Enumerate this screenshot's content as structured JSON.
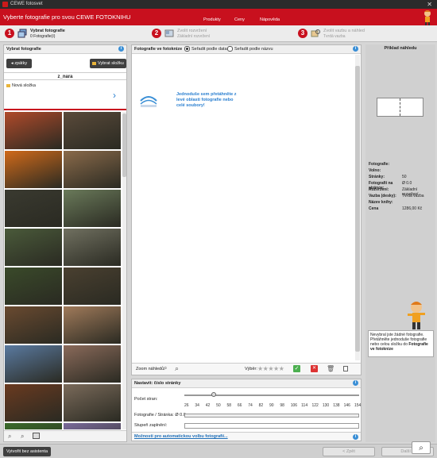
{
  "titlebar": {
    "title": "CEWE fotosvet"
  },
  "header": {
    "title": "Vyberte fotografie pro svou CEWE FOTOKNIHU",
    "nav": [
      "Produkty",
      "Ceny",
      "Nápověda"
    ],
    "assistant": "Asistent CEWE FOTOKNIHY"
  },
  "steps": [
    {
      "num": "1",
      "title": "Vybrat fotografie",
      "subtitle": "0 Fotografie(í)"
    },
    {
      "num": "2",
      "title": "Zvolit rozvržení",
      "subtitle": "Základní rozvržení"
    },
    {
      "num": "3",
      "title": "Zvolit vazbu a náhled",
      "subtitle": "Tvrdá vazba"
    }
  ],
  "left": {
    "heading": "Vybrat fotografie",
    "back": "zpátky",
    "pick_folder": "Vybrat složku",
    "folder_name": "z_nara",
    "new_folder": "Nová složka",
    "photo_colors": [
      "#b04a2a",
      "#5a4a3a",
      "#d06a1a",
      "#8a6a4a",
      "#3a3a30",
      "#6a7a5a",
      "#4a5a3a",
      "#707060",
      "#3a4a2a",
      "#4a4030",
      "#6a4a30",
      "#a07a5a",
      "#5a7aa0",
      "#8a6a5a",
      "#6a3a20",
      "#7a6a5a",
      "#3a6a2a",
      "#7a6a9a"
    ]
  },
  "center": {
    "heading": "Fotografie ve fotoknize",
    "sort_date": "Seřadit podle data",
    "sort_name": "Seřadit podle názvu",
    "drop_hint": "Jednoduše sem přetáhněte z levé oblasti fotografie nebo celé soubory!",
    "zoom_label": "Zoom náhledů:",
    "select_label": "Výběr:",
    "settings_heading": "Nastavit: číslo stránky",
    "pages_label": "Počet stran:",
    "slider_fraction": 0.17,
    "ticks": [
      "26",
      "34",
      "42",
      "50",
      "58",
      "66",
      "74",
      "82",
      "90",
      "98",
      "106",
      "114",
      "122",
      "130",
      "138",
      "146",
      "154"
    ],
    "photos_per_page_label": "Fotografie / Stránka: Ø 0.0",
    "fill_label": "Stupeň zaplnění:",
    "auto_link": "Možnosti pro automatickou volbu fotografií..."
  },
  "right": {
    "preview_heading": "Příklad náhledu",
    "details": [
      {
        "k": "Fotografie:",
        "v": ""
      },
      {
        "k": "Volno:",
        "v": ""
      },
      {
        "k": "Stránky:",
        "v": "50"
      },
      {
        "k": "Fotografií na stránce:",
        "v": "Ø 0.0"
      },
      {
        "k": "Rozvržení:",
        "v": "Základní rozvržení"
      },
      {
        "k": "Vazba (desky):",
        "v": "Tvrdá vazba"
      },
      {
        "k": "Název knihy:",
        "v": ""
      },
      {
        "k": "Cena",
        "v": "1286,00 Kč"
      }
    ],
    "tip": "Nevybral jste žádné fotografie. Přetáhněte jednoduše fotografie nebo celou složku do",
    "tip_bold": "Fotografie ve fotoknize"
  },
  "footer": {
    "exit": "Vytvořit bez asistenta",
    "back": "< Zpět",
    "next": "Další >"
  },
  "colors": {
    "brand_red": "#c8101e",
    "info_blue": "#3a8fd6",
    "link_blue": "#1f6fb8"
  }
}
